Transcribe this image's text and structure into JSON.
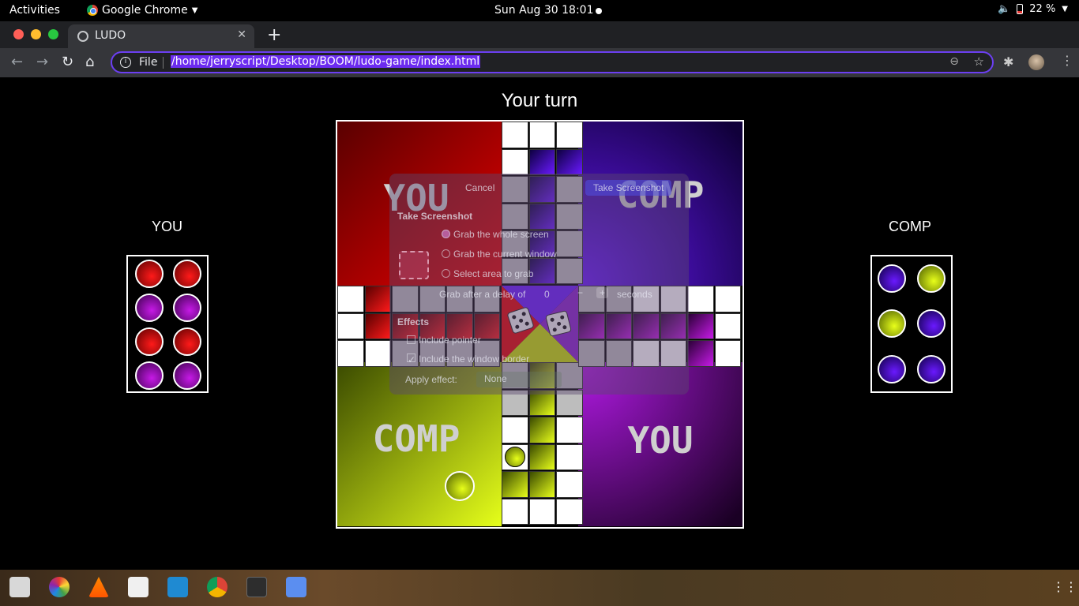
{
  "topbar": {
    "activities": "Activities",
    "app_name": "Google Chrome",
    "clock": "Sun Aug 30  18:01",
    "battery": "22 %"
  },
  "browser": {
    "tab_title": "LUDO",
    "omnibox_scheme": "File",
    "url": "/home/jerryscript/Desktop/BOOM/ludo-game/index.html"
  },
  "game": {
    "status": "Your turn",
    "left_player_label": "YOU",
    "right_player_label": "COMP",
    "board_labels": {
      "top_left": "YOU",
      "top_right": "COMP",
      "bottom_left": "COMP",
      "bottom_right": "YOU"
    },
    "left_home_tokens": [
      "red",
      "red",
      "purple",
      "purple",
      "red",
      "red",
      "purple",
      "purple"
    ],
    "right_home_tokens": [
      "blue",
      "lime",
      "lime",
      "blue",
      "blue",
      "blue"
    ],
    "dice_faces": [
      5,
      3
    ]
  },
  "screenshot_dialog": {
    "cancel": "Cancel",
    "take": "Take Screenshot",
    "heading": "Take Screenshot",
    "options": [
      "Grab the whole screen",
      "Grab the current window",
      "Select area to grab"
    ],
    "delay_label": "Grab after a delay of",
    "delay_value": "0",
    "delay_unit": "seconds",
    "effects_heading": "Effects",
    "include_pointer": "Include pointer",
    "include_border": "Include the window border",
    "apply_effect_label": "Apply effect:",
    "apply_effect_value": "None"
  },
  "colors": {
    "red": "#e60000",
    "blue": "#6a19ff",
    "lime": "#e6ff1a",
    "purple": "#b31ae6",
    "accent": "#6c3ff2"
  }
}
